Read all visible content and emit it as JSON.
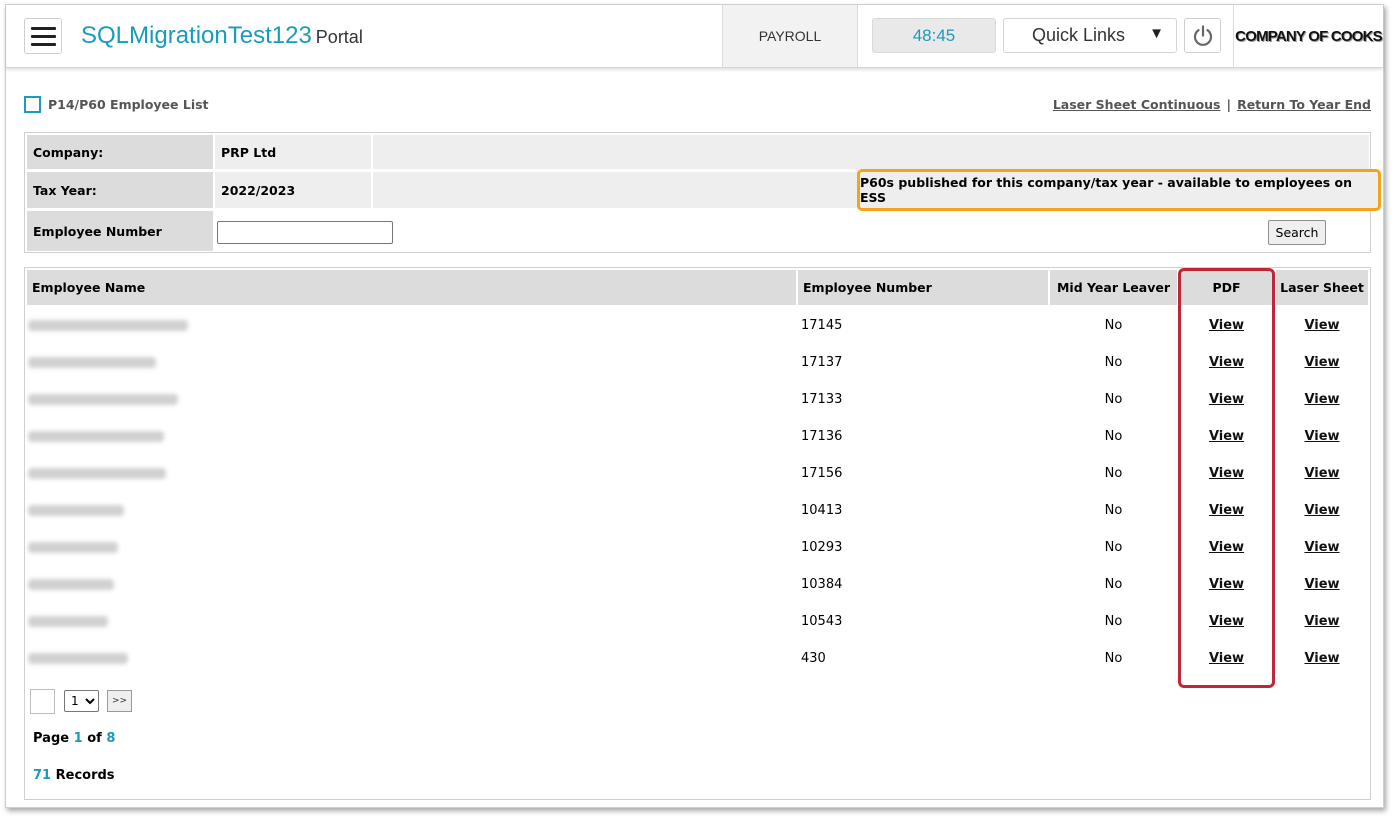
{
  "header": {
    "menu_icon": "hamburger-icon",
    "brand_name": "SQLMigrationTest123",
    "brand_suffix": "Portal",
    "payroll_label": "PAYROLL",
    "session_timer": "48:45",
    "quick_links_label": "Quick Links",
    "quick_links_caret": "▼",
    "power_icon": "power-icon",
    "logo_text": "COMPANY OF COOKS"
  },
  "page": {
    "title": "P14/P60 Employee List",
    "link_laser": "Laser Sheet Continuous",
    "link_separator": "|",
    "link_return": "Return To Year End"
  },
  "info": {
    "company_label": "Company:",
    "company_value": "PRP Ltd",
    "tax_year_label": "Tax Year:",
    "tax_year_value": "2022/2023",
    "notice": "P60s published for this company/tax year - available to employees on ESS",
    "employee_number_label": "Employee Number",
    "employee_number_value": "",
    "search_label": "Search"
  },
  "table": {
    "columns": [
      "Employee Name",
      "Employee Number",
      "Mid Year Leaver",
      "PDF",
      "Laser Sheet"
    ],
    "rows": [
      {
        "number": "17145",
        "leaver": "No",
        "pdf": "View",
        "laser": "View"
      },
      {
        "number": "17137",
        "leaver": "No",
        "pdf": "View",
        "laser": "View"
      },
      {
        "number": "17133",
        "leaver": "No",
        "pdf": "View",
        "laser": "View"
      },
      {
        "number": "17136",
        "leaver": "No",
        "pdf": "View",
        "laser": "View"
      },
      {
        "number": "17156",
        "leaver": "No",
        "pdf": "View",
        "laser": "View"
      },
      {
        "number": "10413",
        "leaver": "No",
        "pdf": "View",
        "laser": "View"
      },
      {
        "number": "10293",
        "leaver": "No",
        "pdf": "View",
        "laser": "View"
      },
      {
        "number": "10384",
        "leaver": "No",
        "pdf": "View",
        "laser": "View"
      },
      {
        "number": "10543",
        "leaver": "No",
        "pdf": "View",
        "laser": "View"
      },
      {
        "number": "430",
        "leaver": "No",
        "pdf": "View",
        "laser": "View"
      }
    ]
  },
  "pagination": {
    "selected_page": "1",
    "next_label": ">>",
    "page_word": "Page",
    "current_page": "1",
    "of_word": "of",
    "total_pages": "8",
    "record_count": "71",
    "records_word": "Records"
  },
  "colors": {
    "brand": "#1a9bbd",
    "notice_border": "#f5a31a",
    "pdf_highlight": "#c0263a"
  }
}
